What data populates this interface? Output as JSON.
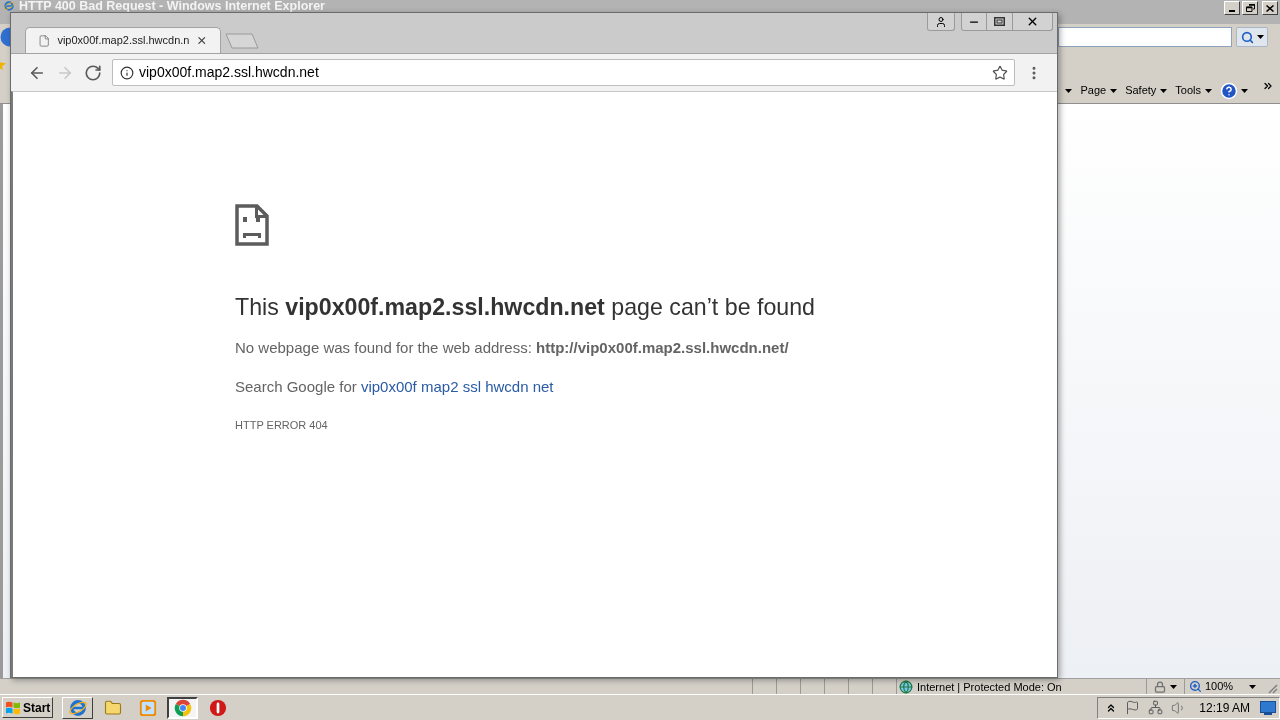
{
  "ie_window": {
    "title": "HTTP 400 Bad Request - Windows Internet Explorer",
    "commands": [
      {
        "label": "Page"
      },
      {
        "label": "Safety"
      },
      {
        "label": "Tools"
      }
    ],
    "status_bar": {
      "zone": "Internet | Protected Mode: On",
      "zoom": "100%"
    }
  },
  "chrome_window": {
    "tabs": [
      {
        "title": "vip0x00f.map2.ssl.hwcdn.n",
        "selected": true
      }
    ],
    "nav_buttons": [
      {
        "kind": "back",
        "disabled": false
      },
      {
        "kind": "forward",
        "disabled": true
      },
      {
        "kind": "reload",
        "disabled": false
      }
    ],
    "address": "vip0x00f.map2.ssl.hwcdn.net",
    "error_page": {
      "heading": "This **vip0x00f.map2.ssl.hwcdn.net** page can’t be found",
      "message": "No webpage was found for the web address: **http://vip0x00f.map2.ssl.hwcdn.net/**",
      "search_prefix": "Search Google for",
      "search_link": "vip0x00f map2 ssl hwcdn net",
      "error_code": "HTTP ERROR 404"
    }
  },
  "taskbar": {
    "start": "Start",
    "items": [
      {
        "kind": "ie",
        "open": true,
        "selected": false
      },
      {
        "kind": "folder",
        "open": false,
        "selected": false
      },
      {
        "kind": "media",
        "open": false,
        "selected": false
      },
      {
        "kind": "chrome",
        "open": true,
        "selected": true
      },
      {
        "kind": "stop",
        "open": false,
        "selected": false
      }
    ],
    "clock": "12:19 AM"
  }
}
